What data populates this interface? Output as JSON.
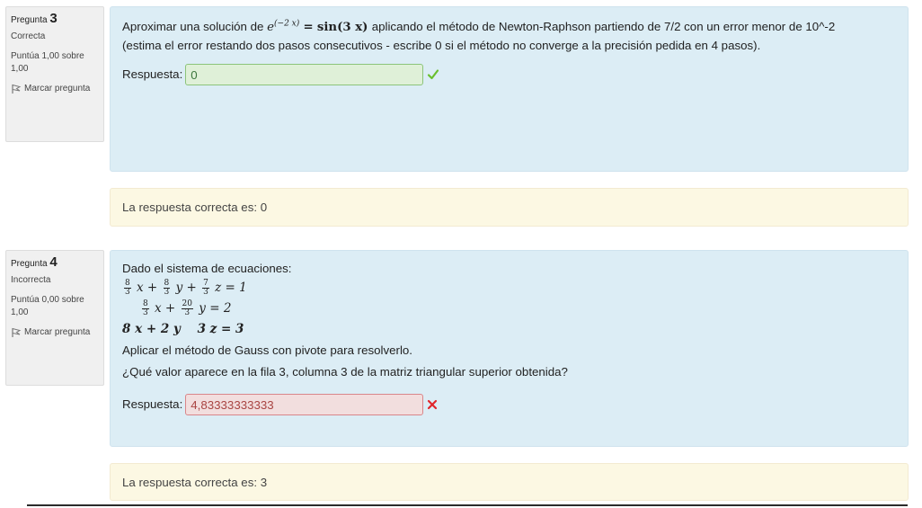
{
  "questions": [
    {
      "label": "Pregunta",
      "number": "3",
      "state": "Correcta",
      "grade": "Puntúa 1,00 sobre 1,00",
      "flag_label": "Marcar pregunta",
      "text_before": "Aproximar una solución de",
      "math_lhs_base": "e",
      "math_lhs_exp": "(−2 x)",
      "math_eq": "=",
      "math_rhs": "sin(3 x)",
      "text_after": "aplicando el método de Newton-Raphson partiendo de 7/2 con un error menor de 10^-2",
      "text_line2": "(estima el error restando dos pasos consecutivos - escribe 0 si el método no converge a la precisión pedida en 4 pasos).",
      "answer_label": "Respuesta:",
      "answer_value": "0",
      "feedback": "La respuesta correcta es: 0"
    },
    {
      "label": "Pregunta",
      "number": "4",
      "state": "Incorrecta",
      "grade": "Puntúa 0,00 sobre 1,00",
      "flag_label": "Marcar pregunta",
      "intro": "Dado el sistema de ecuaciones:",
      "equations": {
        "eq1": {
          "f1n": "8",
          "f1d": "3",
          "t1": "x +",
          "f2n": "8",
          "f2d": "3",
          "t2": "y +",
          "f3n": "7",
          "f3d": "3",
          "t3": "z = 1"
        },
        "eq2": {
          "f1n": "8",
          "f1d": "3",
          "t1": "x +",
          "f2n": "20",
          "f2d": "3",
          "t2": "y = 2"
        },
        "eq3": "8 x + 2 y    3 z = 3"
      },
      "method_text": "Aplicar el método de Gauss con pivote para resolverlo.",
      "question_text": "¿Qué valor aparece en la fila 3, columna 3 de la matriz triangular superior obtenida?",
      "answer_label": "Respuesta:",
      "answer_value": "4,83333333333",
      "feedback": "La respuesta correcta es: 3"
    }
  ],
  "colors": {
    "correct": "#6abf2e",
    "incorrect": "#e0262b"
  },
  "icons": {
    "flag": "flag-icon",
    "correct": "check-icon",
    "incorrect": "cross-icon"
  }
}
